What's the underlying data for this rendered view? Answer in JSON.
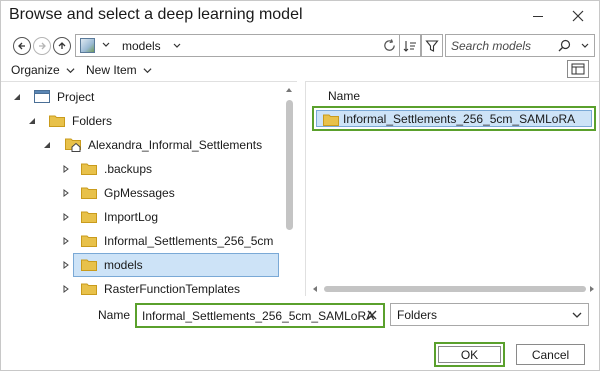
{
  "window": {
    "title": "Browse and select a deep learning model",
    "minimize_icon": "minimize-icon",
    "close_icon": "close-icon"
  },
  "navigation": {
    "back_icon": "arrow-left-icon",
    "forward_icon": "arrow-right-icon",
    "up_icon": "arrow-up-icon",
    "address_text": "models",
    "search_placeholder": "Search models"
  },
  "menu": {
    "organize_label": "Organize",
    "new_item_label": "New Item"
  },
  "tree": {
    "items": [
      {
        "label": "Project",
        "icon": "project-icon",
        "expanded": true
      },
      {
        "label": "Folders",
        "icon": "folder-icon",
        "expanded": true
      },
      {
        "label": "Alexandra_Informal_Settlements",
        "icon": "home-folder-icon",
        "expanded": true
      },
      {
        "label": ".backups",
        "icon": "folder-icon",
        "expanded": false
      },
      {
        "label": "GpMessages",
        "icon": "folder-icon",
        "expanded": false
      },
      {
        "label": "ImportLog",
        "icon": "folder-icon",
        "expanded": false
      },
      {
        "label": "Informal_Settlements_256_5cm",
        "icon": "folder-icon",
        "expanded": false
      },
      {
        "label": "models",
        "icon": "folder-icon",
        "expanded": false,
        "selected": true
      },
      {
        "label": "RasterFunctionTemplates",
        "icon": "folder-icon",
        "expanded": false
      }
    ]
  },
  "contents": {
    "column_header": "Name",
    "items": [
      {
        "label": "Informal_Settlements_256_5cm_SAMLoRA",
        "icon": "folder-icon",
        "selected": true
      }
    ]
  },
  "footer": {
    "name_label": "Name",
    "name_value": "Informal_Settlements_256_5cm_SAMLoRA",
    "type_value": "Folders",
    "ok_label": "OK",
    "cancel_label": "Cancel"
  },
  "colors": {
    "highlight_green": "#5aa02c",
    "selection_blue": "#cde3f7",
    "folder_yellow": "#e8c14a"
  }
}
